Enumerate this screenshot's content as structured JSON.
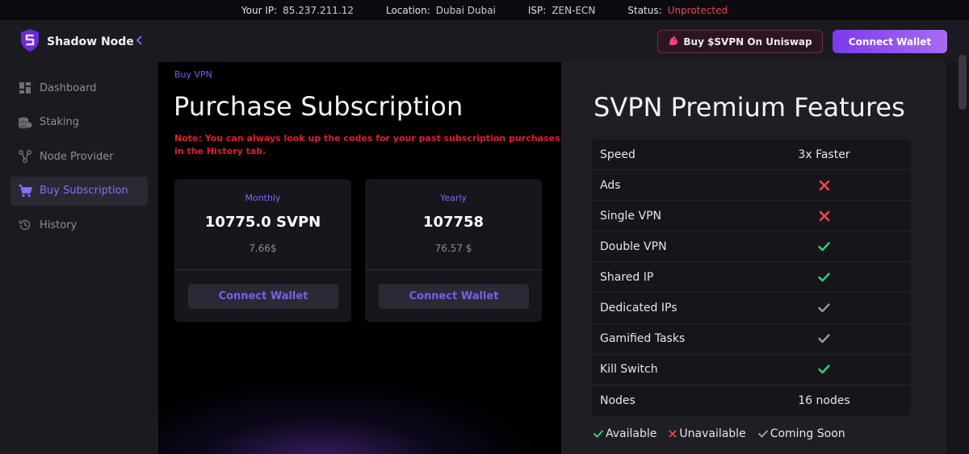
{
  "status_bar": {
    "ip_label": "Your IP:",
    "ip_value": "85.237.211.12",
    "location_label": "Location:",
    "location_value": "Dubai Dubai",
    "isp_label": "ISP:",
    "isp_value": "ZEN-ECN",
    "status_label": "Status:",
    "status_value": "Unprotected"
  },
  "brand": {
    "name": "Shadow Node",
    "logo_icon": "shield-s-logo-icon",
    "collapse_icon": "chevron-left-icon"
  },
  "sidebar": {
    "items": [
      {
        "label": "Dashboard",
        "icon": "dashboard-grid-icon"
      },
      {
        "label": "Staking",
        "icon": "coins-stack-icon"
      },
      {
        "label": "Node Provider",
        "icon": "node-graph-icon"
      },
      {
        "label": "Buy Subscription",
        "icon": "cart-icon",
        "active": true
      },
      {
        "label": "History",
        "icon": "history-clock-icon"
      }
    ]
  },
  "header": {
    "uniswap_label": "Buy $SVPN On Uniswap",
    "uniswap_icon": "unicorn-icon",
    "connect_label": "Connect Wallet"
  },
  "main": {
    "breadcrumb": "Buy VPN",
    "title": "Purchase Subscription",
    "note": "Note: You can always look up the codes for your past subscription purchases in the History tab.",
    "plans": [
      {
        "period": "Monthly",
        "amount": "10775.0 SVPN",
        "price": "7.66$",
        "button": "Connect Wallet"
      },
      {
        "period": "Yearly",
        "amount": "107758",
        "price": "76.57 $",
        "button": "Connect Wallet"
      }
    ]
  },
  "features": {
    "title": "SVPN Premium Features",
    "rows": [
      {
        "name": "Speed",
        "value": "3x Faster"
      },
      {
        "name": "Ads",
        "icon": "cross-icon"
      },
      {
        "name": "Single VPN",
        "icon": "cross-icon"
      },
      {
        "name": "Double VPN",
        "icon": "check-icon"
      },
      {
        "name": "Shared IP",
        "icon": "check-icon"
      },
      {
        "name": "Dedicated IPs",
        "icon": "check-gray-icon"
      },
      {
        "name": "Gamified Tasks",
        "icon": "check-gray-icon"
      },
      {
        "name": "Kill Switch",
        "icon": "check-icon"
      },
      {
        "name": "Nodes",
        "value": "16 nodes"
      }
    ],
    "legend": {
      "available": "Available",
      "unavailable": "Unavailable",
      "coming_soon": "Coming Soon"
    }
  },
  "colors": {
    "accent": "#7c3aed",
    "available": "#2fd07a",
    "unavailable": "#e5484d",
    "coming_soon": "#9a98a2",
    "danger": "#e11d2b"
  }
}
